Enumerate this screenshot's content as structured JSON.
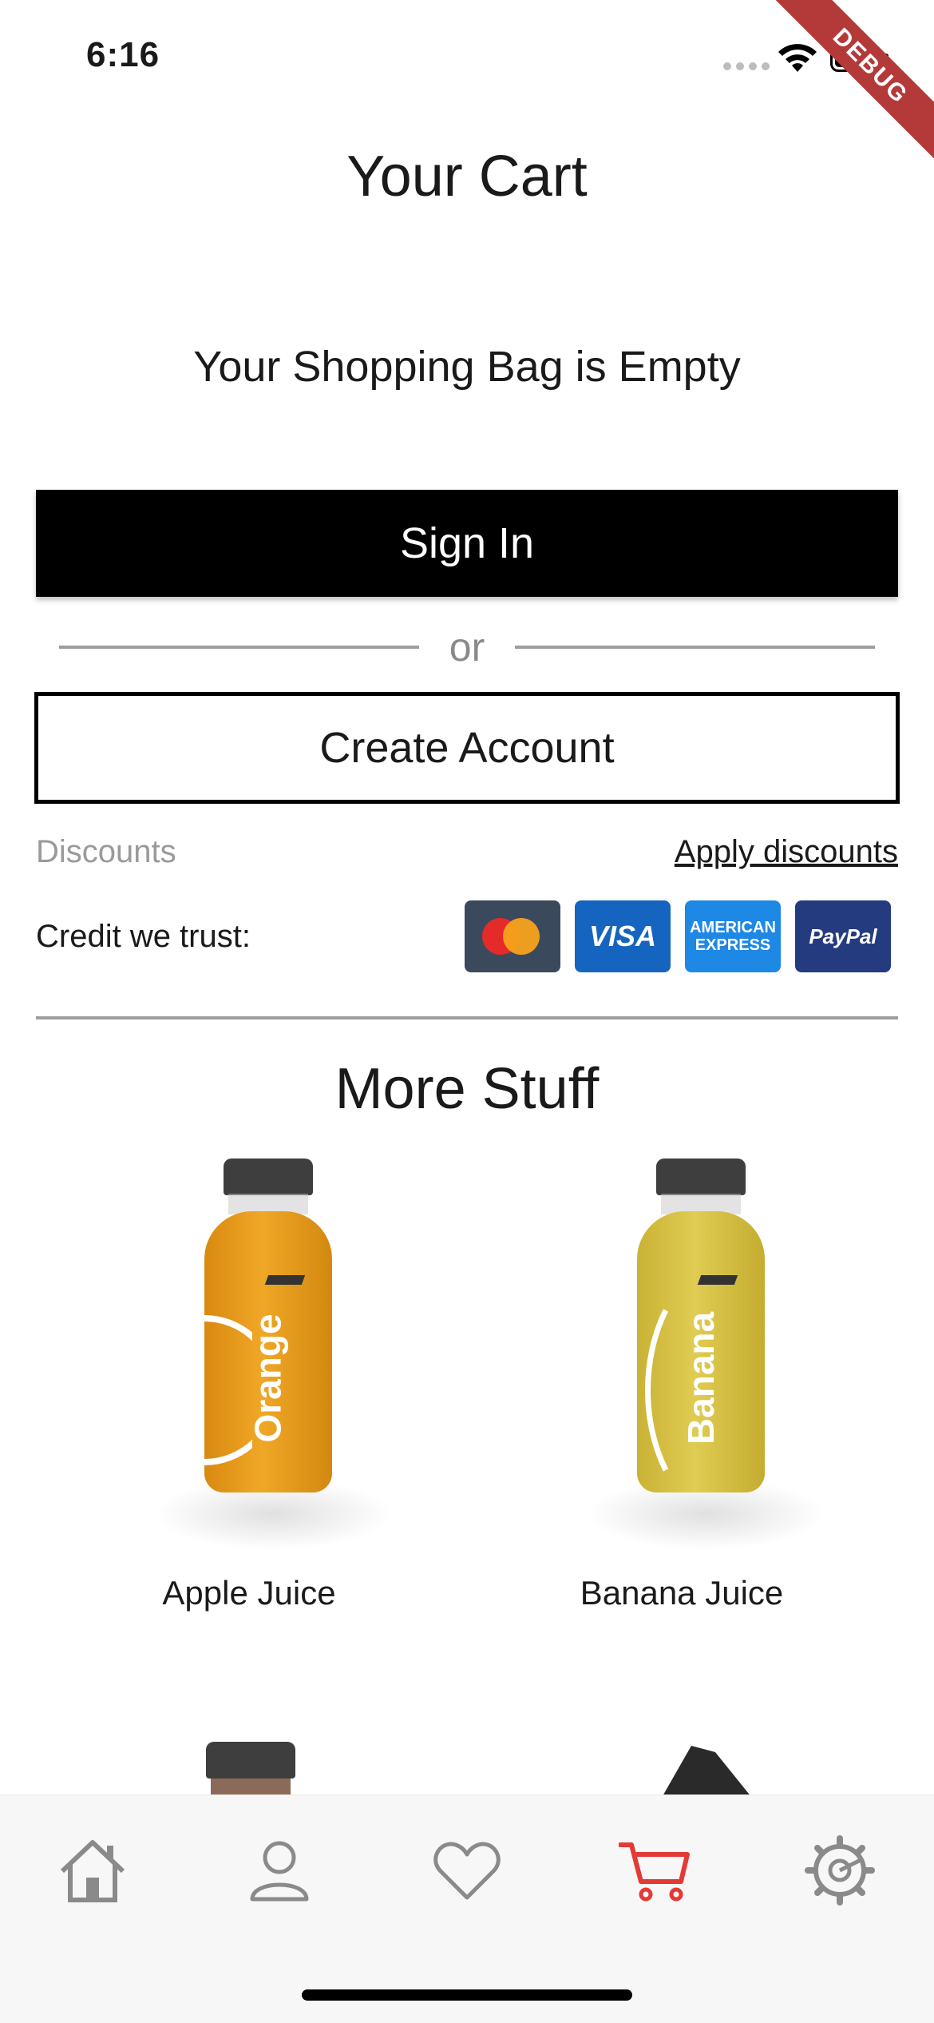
{
  "status_bar": {
    "time": "6:16",
    "debug_label": "DEBUG"
  },
  "header": {
    "title": "Your Cart"
  },
  "cart": {
    "empty_message": "Your Shopping Bag is Empty"
  },
  "auth": {
    "sign_in_label": "Sign In",
    "or_label": "or",
    "create_account_label": "Create Account"
  },
  "discounts": {
    "label": "Discounts",
    "apply_link": "Apply discounts"
  },
  "payment": {
    "label": "Credit we trust:",
    "cards": [
      {
        "icon": "mastercard-icon",
        "text": ""
      },
      {
        "icon": "visa-icon",
        "text": "VISA"
      },
      {
        "icon": "amex-icon",
        "text_top": "AMERICAN",
        "text_bottom": "EXPRESS"
      },
      {
        "icon": "paypal-icon",
        "text": "PayPal"
      }
    ]
  },
  "more_stuff": {
    "title": "More Stuff",
    "products": [
      {
        "name": "Apple Juice",
        "bottle_text": "Orange",
        "bottle_color": "#e79a17"
      },
      {
        "name": "Banana Juice",
        "bottle_text": "Banana",
        "bottle_color": "#d6c03c"
      }
    ]
  },
  "tab_bar": {
    "items": [
      {
        "icon": "home-icon",
        "active": false
      },
      {
        "icon": "profile-icon",
        "active": false
      },
      {
        "icon": "heart-icon",
        "active": false
      },
      {
        "icon": "cart-icon",
        "active": true
      },
      {
        "icon": "settings-icon",
        "active": false
      }
    ],
    "active_color": "#e53935",
    "inactive_color": "#8a8a8a"
  }
}
